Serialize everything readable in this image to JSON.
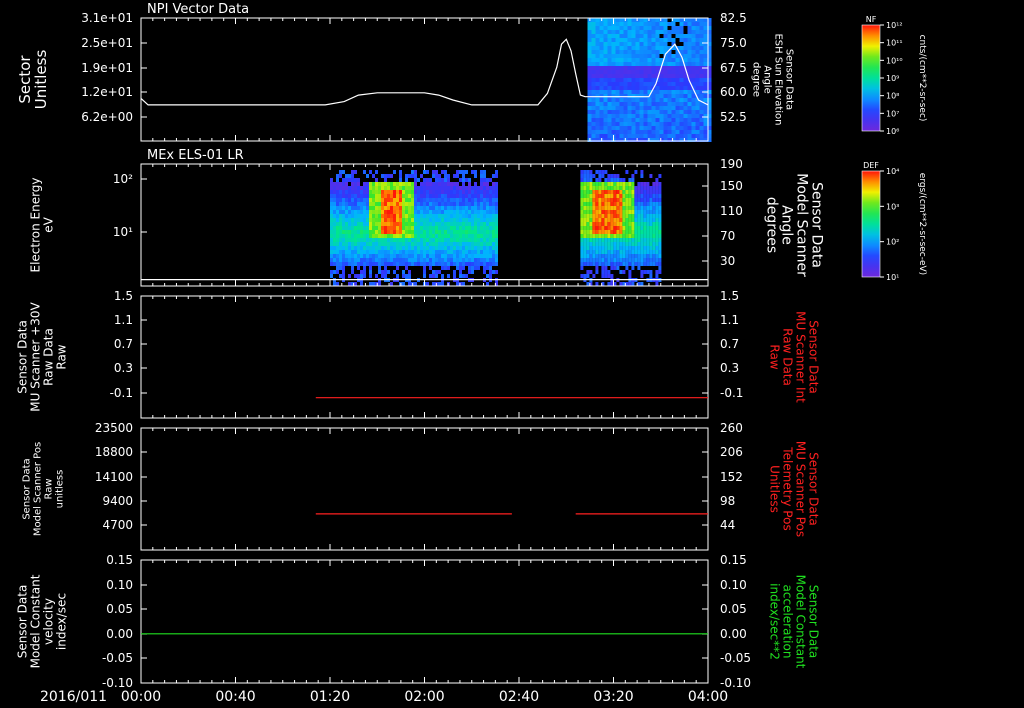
{
  "panels": [
    {
      "title": "NPI Vector Data",
      "ylabel_left": [
        "Sector",
        "Unitless"
      ],
      "yticks_left": [
        "3.1e+01",
        "2.5e+01",
        "1.9e+01",
        "1.2e+01",
        "6.2e+00"
      ],
      "ylabel_right": [
        "Sensor Data",
        "ESH Sun Elevation",
        "Angle",
        "degree"
      ],
      "yticks_right": [
        "82.5",
        "75.0",
        "67.5",
        "60.0",
        "52.5"
      ],
      "right_label_color": "#ffffff"
    },
    {
      "title": "MEx ELS-01 LR",
      "ylabel_left": [
        "Electron Energy",
        "eV"
      ],
      "yticks_left": [
        "10²",
        "10¹"
      ],
      "ylabel_right": [
        "Sensor Data",
        "Model Scanner",
        "Angle",
        "degrees"
      ],
      "yticks_right": [
        "190",
        "150",
        "110",
        "70",
        "30"
      ],
      "right_label_color": "#ffffff"
    },
    {
      "title": "",
      "ylabel_left": [
        "Sensor Data",
        "MU Scanner +30V",
        "Raw Data",
        "Raw"
      ],
      "yticks_left": [
        "1.5",
        "1.1",
        "0.7",
        "0.3",
        "-0.1"
      ],
      "ylabel_right": [
        "Sensor Data",
        "MU Scanner Int",
        "Raw Data",
        "Raw"
      ],
      "yticks_right": [
        "1.5",
        "1.1",
        "0.7",
        "0.3",
        "-0.1"
      ],
      "right_label_color": "#ff2020"
    },
    {
      "title": "",
      "ylabel_left": [
        "Sensor Data",
        "Model Scanner Pos",
        "Raw",
        "unitless"
      ],
      "yticks_left": [
        "23500",
        "18800",
        "14100",
        "9400",
        "4700"
      ],
      "ylabel_right": [
        "Sensor Data",
        "MU Scanner Pos",
        "Telemetry Pos",
        "Unitless"
      ],
      "yticks_right": [
        "260",
        "206",
        "152",
        "98",
        "44"
      ],
      "right_label_color": "#ff2020"
    },
    {
      "title": "",
      "ylabel_left": [
        "Sensor Data",
        "Model Constant",
        "velocity",
        "index/sec"
      ],
      "yticks_left": [
        "0.15",
        "0.10",
        "0.05",
        "0.00",
        "-0.05",
        "-0.10"
      ],
      "ylabel_right": [
        "Sensor Data",
        "Model Constant",
        "acceleration",
        "index/sec**2"
      ],
      "yticks_right": [
        "0.15",
        "0.10",
        "0.05",
        "0.00",
        "-0.05",
        "-0.10"
      ],
      "right_label_color": "#20e020"
    }
  ],
  "x_axis": {
    "date": "2016/011",
    "ticks": [
      "00:00",
      "00:40",
      "01:20",
      "02:00",
      "02:40",
      "03:20",
      "04:00"
    ]
  },
  "colorbars": [
    {
      "title": "NF",
      "ticks": [
        "10¹²",
        "10¹¹",
        "10¹⁰",
        "10⁹",
        "10⁸",
        "10⁷",
        "10⁶"
      ],
      "units": "cnts/(cm**2-sr-sec)"
    },
    {
      "title": "DEF",
      "ticks": [
        "10⁴",
        "10³",
        "10²",
        "10¹"
      ],
      "units": "ergs/(cm**2-sr-sec-eV)"
    }
  ],
  "chart_data": [
    {
      "type": "line",
      "panel": 0,
      "name": "ESH Sun Elevation Angle",
      "x_minutes": [
        0,
        3,
        8,
        20,
        40,
        60,
        78,
        86,
        92,
        100,
        110,
        120,
        126,
        132,
        140,
        150,
        160,
        168,
        172,
        176,
        178,
        180,
        182,
        184,
        186,
        188,
        190,
        200,
        215,
        218,
        222,
        226,
        229,
        232,
        236,
        240
      ],
      "y_degrees": [
        60.5,
        58.5,
        58.5,
        58.5,
        58.5,
        58.5,
        58.5,
        59.5,
        61.5,
        62.2,
        62.2,
        62.2,
        61.5,
        60.0,
        58.5,
        58.5,
        58.5,
        58.5,
        62,
        70,
        77,
        78.5,
        75,
        68,
        61.5,
        61,
        61,
        61,
        61,
        65,
        74,
        77,
        73,
        66,
        60,
        58.5
      ],
      "color": "#ffffff",
      "ylim": [
        47.5,
        85
      ]
    },
    {
      "type": "heatmap",
      "panel": 0,
      "name": "NPI Vector Data",
      "x_range_minutes": [
        189,
        240
      ],
      "color": "NF"
    },
    {
      "type": "heatmap",
      "panel": 1,
      "name": "MEx ELS-01 LR",
      "x_ranges_minutes": [
        [
          80,
          151
        ],
        [
          186,
          220
        ]
      ],
      "energy_range_eV": [
        1,
        200
      ],
      "intense_region_minutes": [
        [
          101,
          110
        ],
        [
          190,
          203
        ]
      ],
      "color": "DEF"
    },
    {
      "type": "line",
      "panel": 1,
      "name": "Model Scanner Angle",
      "x_minutes": [
        0,
        240
      ],
      "y_degrees": [
        10,
        10
      ],
      "color": "#ffffff",
      "ylim": [
        0,
        190
      ]
    },
    {
      "type": "line",
      "panel": 2,
      "name": "MU Scanner Int Raw Data",
      "segments": [
        {
          "x_minutes": [
            74,
            240
          ],
          "y": [
            0,
            0
          ]
        }
      ],
      "color": "#ff2020",
      "ylim": [
        -0.3,
        1.5
      ]
    },
    {
      "type": "line",
      "panel": 3,
      "name": "MU Scanner Pos Telemetry Pos",
      "segments": [
        {
          "x_minutes": [
            74,
            157
          ],
          "y": [
            89,
            89
          ]
        },
        {
          "x_minutes": [
            184,
            240
          ],
          "y": [
            89,
            89
          ]
        }
      ],
      "color": "#ff2020",
      "ylim": [
        17,
        260
      ]
    },
    {
      "type": "line",
      "panel": 4,
      "name": "Model Constant acceleration",
      "segments": [
        {
          "x_minutes": [
            0,
            240
          ],
          "y": [
            0,
            0
          ]
        }
      ],
      "color": "#20e020",
      "ylim": [
        -0.1,
        0.15
      ]
    }
  ]
}
